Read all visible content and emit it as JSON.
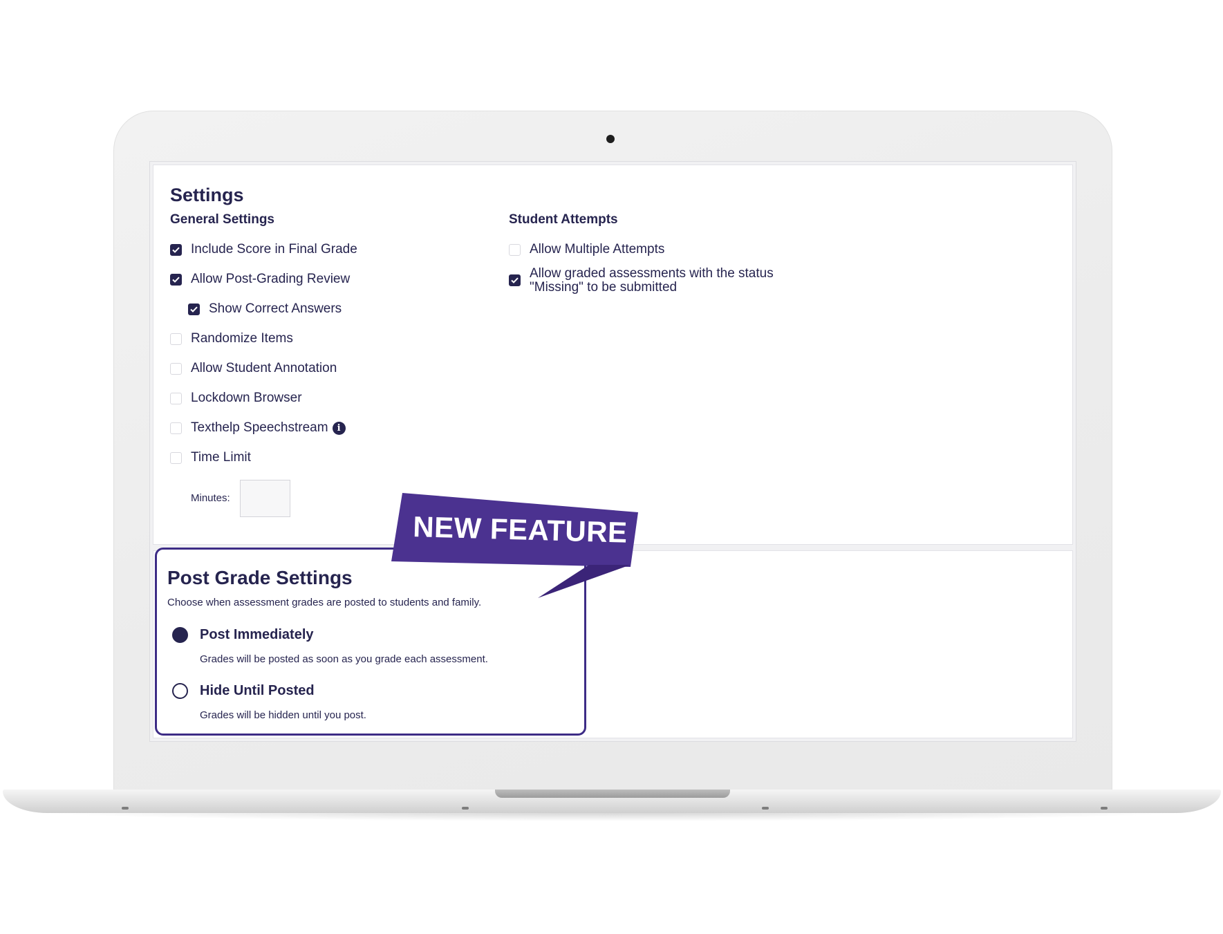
{
  "settings": {
    "title": "Settings",
    "general": {
      "heading": "General Settings",
      "items": [
        {
          "label": "Include Score in Final Grade",
          "checked": true
        },
        {
          "label": "Allow Post-Grading Review",
          "checked": true
        },
        {
          "label": "Show Correct Answers",
          "checked": true
        },
        {
          "label": "Randomize Items",
          "checked": false
        },
        {
          "label": "Allow Student Annotation",
          "checked": false
        },
        {
          "label": "Lockdown Browser",
          "checked": false
        },
        {
          "label": "Texthelp Speechstream",
          "checked": false
        },
        {
          "label": "Time Limit",
          "checked": false
        }
      ],
      "minutes_label": "Minutes:",
      "minutes_value": ""
    },
    "student_attempts": {
      "heading": "Student Attempts",
      "items": [
        {
          "label": "Allow Multiple Attempts",
          "checked": false
        },
        {
          "label": "Allow graded assessments with the status\n\"Missing\" to be submitted",
          "checked": true
        }
      ]
    }
  },
  "post_grade": {
    "title": "Post Grade Settings",
    "subtitle": "Choose when assessment grades are posted to students and family.",
    "options": [
      {
        "label": "Post Immediately",
        "description": "Grades will be posted as soon as you grade each assessment.",
        "selected": true
      },
      {
        "label": "Hide Until Posted",
        "description": "Grades will be hidden until you post.",
        "selected": false
      }
    ]
  },
  "banner": {
    "text": "NEW FEATURE",
    "color": "#4b3290"
  },
  "colors": {
    "navy": "#26244f",
    "accent": "#3d2c86"
  }
}
